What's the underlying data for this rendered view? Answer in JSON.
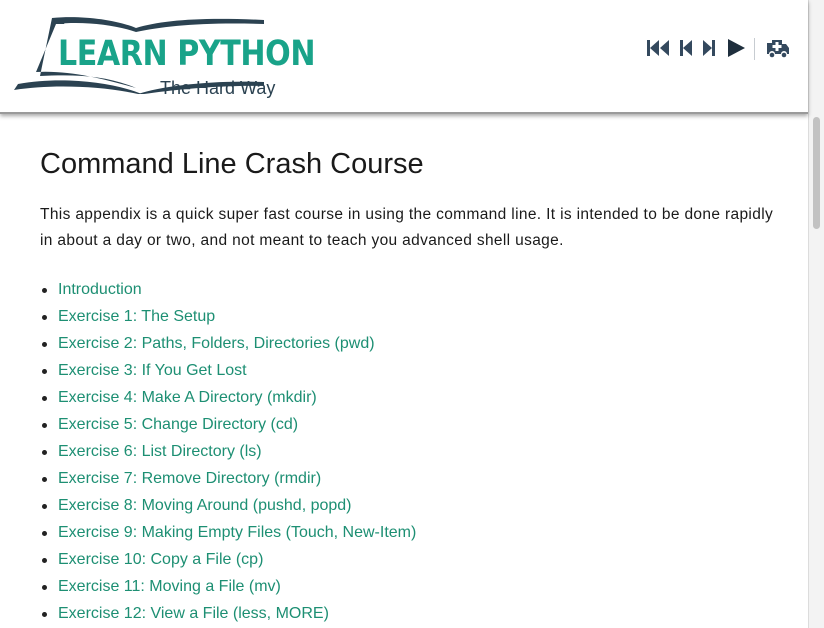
{
  "colors": {
    "link": "#1d8f73",
    "logo_teal": "#19a389",
    "logo_dark": "#2b4251",
    "nav_icon": "#34495e"
  },
  "logo": {
    "line1": "LEARN PYTHON",
    "line2": "The Hard Way"
  },
  "nav": {
    "first_icon": "skip-to-first-icon",
    "prev_icon": "previous-icon",
    "next_icon": "next-icon",
    "play_icon": "play-icon",
    "help_icon": "ambulance-icon"
  },
  "main": {
    "title": "Command Line Crash Course",
    "intro": "This appendix is a quick super fast course in using the command line. It is intended to be done rapidly in about a day or two, and not meant to teach you advanced shell usage.",
    "toc": [
      "Introduction",
      "Exercise 1: The Setup",
      "Exercise 2: Paths, Folders, Directories (pwd)",
      "Exercise 3: If You Get Lost",
      "Exercise 4: Make A Directory (mkdir)",
      "Exercise 5: Change Directory (cd)",
      "Exercise 6: List Directory (ls)",
      "Exercise 7: Remove Directory (rmdir)",
      "Exercise 8: Moving Around (pushd, popd)",
      "Exercise 9: Making Empty Files (Touch, New-Item)",
      "Exercise 10: Copy a File (cp)",
      "Exercise 11: Moving a File (mv)",
      "Exercise 12: View a File (less, MORE)"
    ]
  }
}
